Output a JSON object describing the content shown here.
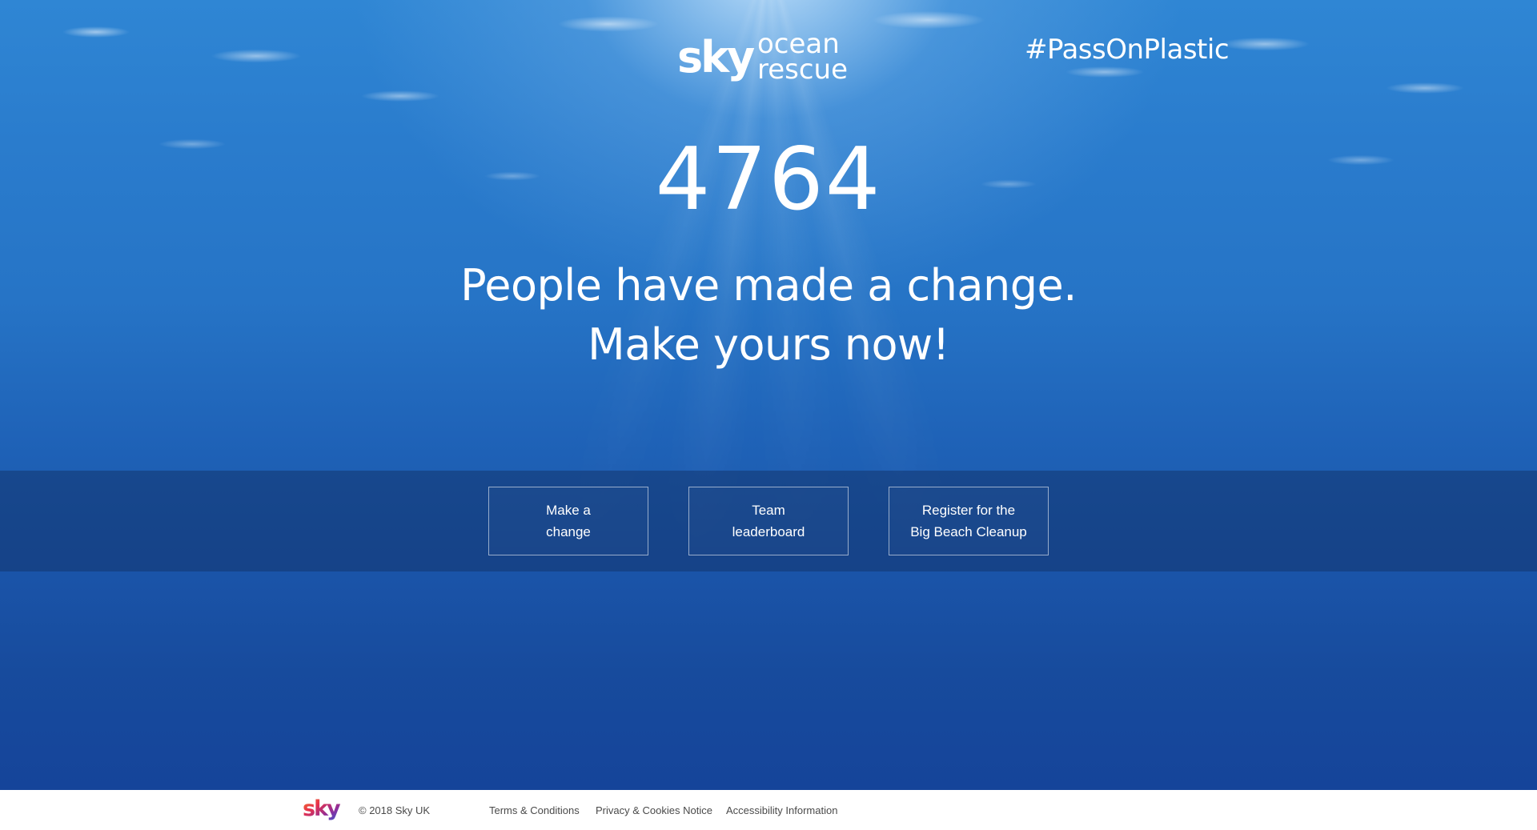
{
  "brand": {
    "logo_sky": "sky",
    "logo_line1": "ocean",
    "logo_line2": "rescue"
  },
  "hashtag": "#PassOnPlastic",
  "counter": {
    "value": "4764"
  },
  "headline": {
    "line1": "People have made a change.",
    "line2": "Make yours now!"
  },
  "actions": [
    {
      "line1": "Make a",
      "line2": "change"
    },
    {
      "line1": "Team",
      "line2": "leaderboard"
    },
    {
      "line1": "Register for the",
      "line2": "Big Beach Cleanup"
    }
  ],
  "footer": {
    "logo_text": "sky",
    "copyright": "© 2018 Sky UK",
    "links": [
      "Terms & Conditions",
      "Privacy & Cookies Notice",
      "Accessibility Information"
    ]
  },
  "colors": {
    "ocean_top": "#2f86d4",
    "ocean_bottom": "#15449a",
    "action_bar": "#12346e",
    "text_on_ocean": "#ffffff",
    "footer_text": "#4a4a4a"
  }
}
